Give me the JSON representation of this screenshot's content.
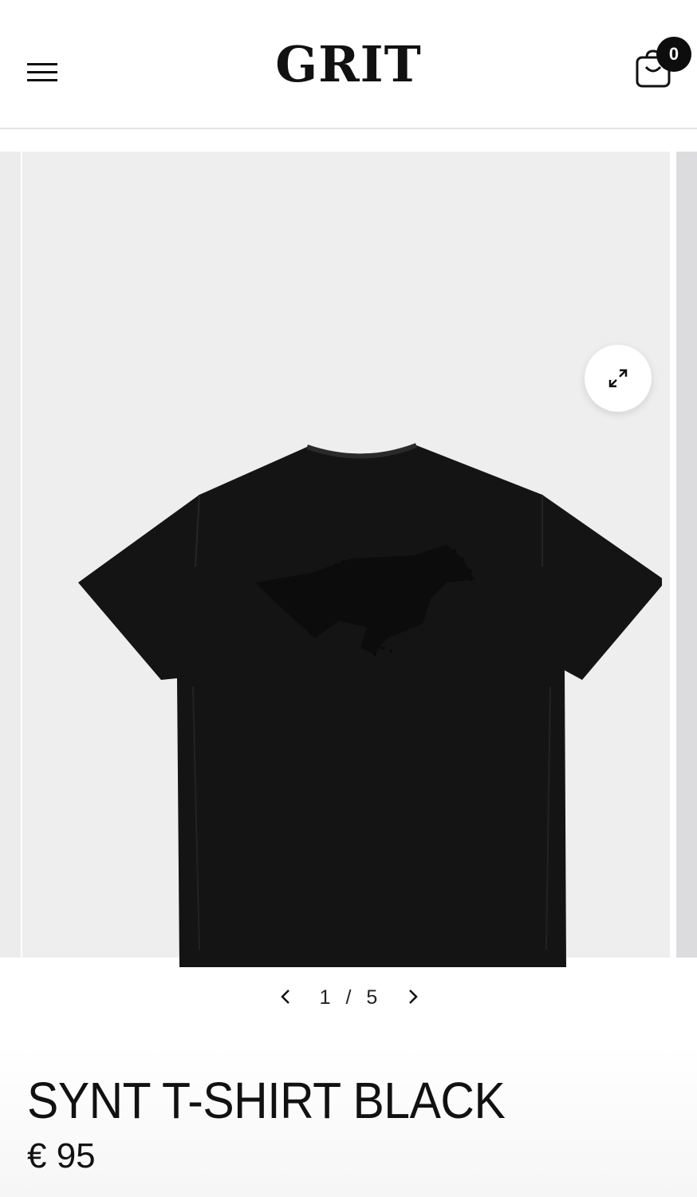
{
  "header": {
    "logo": "GRIT",
    "cart_count": "0",
    "menu_icon": "hamburger-menu-icon",
    "cart_icon": "shopping-bag-icon"
  },
  "gallery": {
    "image_subject": "black t-shirt back view with dotted running horse print",
    "zoom_icon": "expand-arrows-icon",
    "current_index": "1",
    "separator": "/",
    "total": "5"
  },
  "product": {
    "title": "SYNT T-SHIRT BLACK",
    "price": "€ 95"
  },
  "colors": {
    "shirt": "#141414",
    "image_bg": "#eeeeee",
    "badge": "#0d0d0d",
    "divider": "#e3e3e3"
  }
}
